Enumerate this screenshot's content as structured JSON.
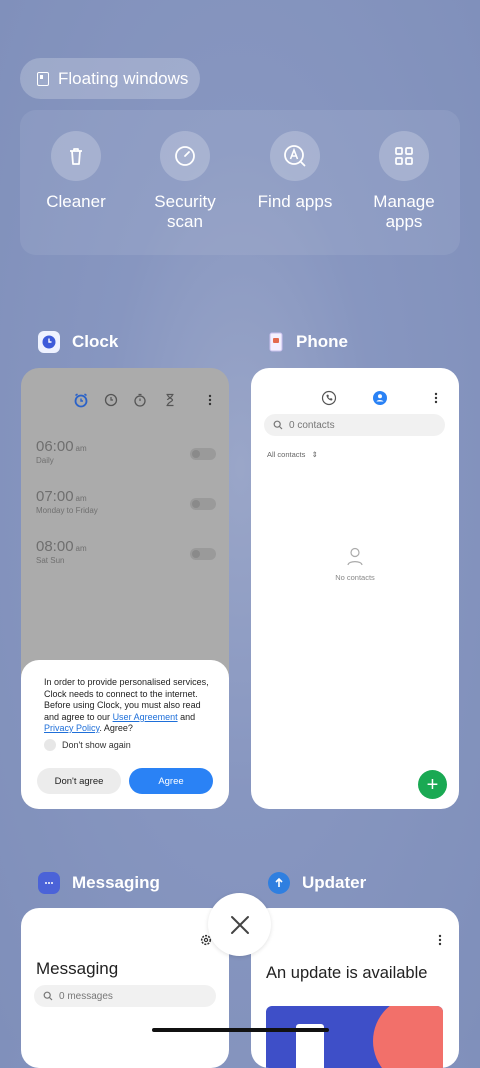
{
  "floating_windows": {
    "label": "Floating windows"
  },
  "tools": [
    {
      "label": "Cleaner",
      "icon": "trash-icon"
    },
    {
      "label": "Security\nscan",
      "icon": "security-icon"
    },
    {
      "label": "Find apps",
      "icon": "find-apps-icon"
    },
    {
      "label": "Manage\napps",
      "icon": "grid-icon"
    }
  ],
  "apps": {
    "clock": {
      "name": "Clock",
      "alarms": [
        {
          "time": "06:00",
          "ampm": "am",
          "repeat": "Daily"
        },
        {
          "time": "07:00",
          "ampm": "am",
          "repeat": "Monday to Friday"
        },
        {
          "time": "08:00",
          "ampm": "am",
          "repeat": "Sat Sun"
        }
      ],
      "dialog": {
        "text_part1": "In order to provide personalised services, Clock needs to connect to the internet. Before using Clock, you must also read and agree to our ",
        "link1": "User Agreement",
        "and": " and ",
        "link2": "Privacy Policy",
        "text_part2": ". Agree?",
        "checkbox_label": "Don't show again",
        "disagree": "Don't agree",
        "agree": "Agree"
      }
    },
    "phone": {
      "name": "Phone",
      "search_placeholder": "0 contacts",
      "filter": "All contacts",
      "empty_text": "No contacts",
      "fab": "+"
    },
    "messaging": {
      "name": "Messaging",
      "title": "Messaging",
      "search_placeholder": "0 messages"
    },
    "updater": {
      "name": "Updater",
      "title": "An update is available"
    }
  },
  "colors": {
    "accent_blue": "#2a82f5",
    "fab_green": "#1aa953",
    "link_blue": "#1e6fd9"
  }
}
